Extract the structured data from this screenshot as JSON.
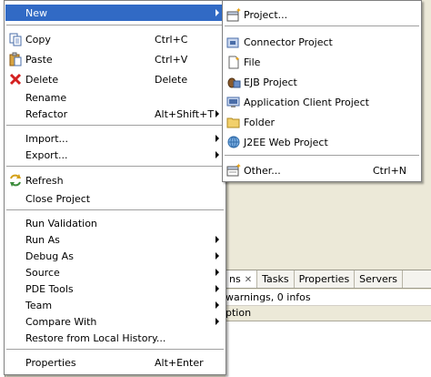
{
  "background": {
    "tabs": [
      "ns",
      "Tasks",
      "Properties",
      "Servers"
    ],
    "problems_status": "warnings, 0 infos",
    "table_header": "ption"
  },
  "context_menu": {
    "items": [
      {
        "label": "New",
        "icon": "none",
        "submenu": true
      },
      {
        "label": "Copy",
        "icon": "copy-icon",
        "accel": "Ctrl+C"
      },
      {
        "label": "Paste",
        "icon": "paste-icon",
        "accel": "Ctrl+V"
      },
      {
        "label": "Delete",
        "icon": "delete-icon",
        "accel": "Delete"
      },
      {
        "label": "Rename"
      },
      {
        "label": "Refactor",
        "accel": "Alt+Shift+T",
        "submenu": true
      },
      {
        "label": "Import...",
        "submenu": true
      },
      {
        "label": "Export...",
        "submenu": true
      },
      {
        "label": "Refresh",
        "icon": "refresh-icon"
      },
      {
        "label": "Close Project"
      },
      {
        "label": "Run Validation"
      },
      {
        "label": "Run As",
        "submenu": true
      },
      {
        "label": "Debug As",
        "submenu": true
      },
      {
        "label": "Source",
        "submenu": true
      },
      {
        "label": "PDE Tools",
        "submenu": true
      },
      {
        "label": "Team",
        "submenu": true
      },
      {
        "label": "Compare With",
        "submenu": true
      },
      {
        "label": "Restore from Local History..."
      },
      {
        "label": "Properties",
        "accel": "Alt+Enter"
      }
    ]
  },
  "new_submenu": {
    "items": [
      {
        "label": "Project...",
        "icon": "new-project-icon"
      },
      {
        "label": "Connector Project",
        "icon": "connector-project-icon"
      },
      {
        "label": "File",
        "icon": "new-file-icon"
      },
      {
        "label": "EJB Project",
        "icon": "ejb-project-icon"
      },
      {
        "label": "Application Client Project",
        "icon": "app-client-project-icon"
      },
      {
        "label": "Folder",
        "icon": "folder-icon"
      },
      {
        "label": "J2EE Web Project",
        "icon": "web-project-icon"
      },
      {
        "label": "Other...",
        "icon": "other-wizard-icon",
        "accel": "Ctrl+N"
      }
    ]
  },
  "colors": {
    "highlight": "#316ac5",
    "menu_bg": "#ffffff",
    "window_bg": "#ece9d8"
  }
}
